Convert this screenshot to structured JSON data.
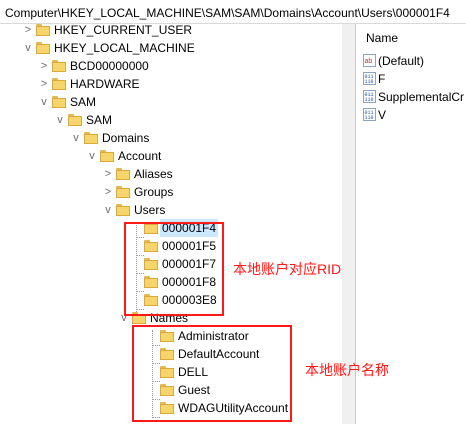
{
  "address_bar": "Computer\\HKEY_LOCAL_MACHINE\\SAM\\SAM\\Domains\\Account\\Users\\000001F4",
  "tree": [
    {
      "label": "HKEY_CURRENT_USER",
      "toggle": ">"
    },
    {
      "label": "HKEY_LOCAL_MACHINE",
      "toggle": "v"
    },
    {
      "label": "BCD00000000",
      "toggle": ">"
    },
    {
      "label": "HARDWARE",
      "toggle": ">"
    },
    {
      "label": "SAM",
      "toggle": "v"
    },
    {
      "label": "SAM",
      "toggle": "v"
    },
    {
      "label": "Domains",
      "toggle": "v"
    },
    {
      "label": "Account",
      "toggle": "v"
    },
    {
      "label": "Aliases",
      "toggle": ">"
    },
    {
      "label": "Groups",
      "toggle": ">"
    },
    {
      "label": "Users",
      "toggle": "v"
    },
    {
      "label": "000001F4",
      "toggle": "",
      "selected": true
    },
    {
      "label": "000001F5",
      "toggle": ""
    },
    {
      "label": "000001F7",
      "toggle": ""
    },
    {
      "label": "000001F8",
      "toggle": ""
    },
    {
      "label": "000003E8",
      "toggle": ""
    },
    {
      "label": "Names",
      "toggle": "v"
    },
    {
      "label": "Administrator",
      "toggle": ""
    },
    {
      "label": "DefaultAccount",
      "toggle": ""
    },
    {
      "label": "DELL",
      "toggle": ""
    },
    {
      "label": "Guest",
      "toggle": ""
    },
    {
      "label": "WDAGUtilityAccount",
      "toggle": ""
    }
  ],
  "annotations": {
    "rid_note": "本地账户对应RID",
    "name_note": "本地账户名称"
  },
  "values_pane": {
    "column_name": "Name",
    "values": [
      {
        "name": "(Default)",
        "icon": "string-value-icon"
      },
      {
        "name": "F",
        "icon": "binary-value-icon"
      },
      {
        "name": "SupplementalCr",
        "icon": "binary-value-icon"
      },
      {
        "name": "V",
        "icon": "binary-value-icon"
      }
    ]
  },
  "colors": {
    "annotation": "#ff1a1a",
    "folder": "#f6d46e",
    "selection": "#cce8ff"
  }
}
